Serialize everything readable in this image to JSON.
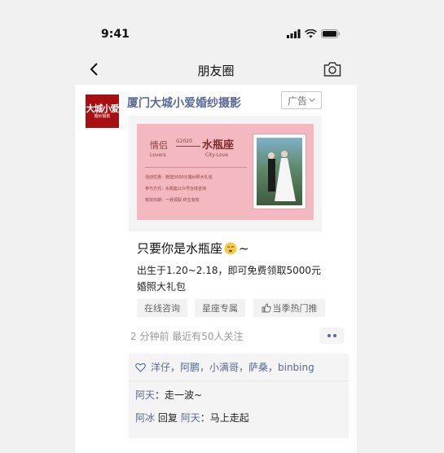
{
  "status_bar": {
    "time": "9:41"
  },
  "nav": {
    "title": "朋友圈"
  },
  "post": {
    "author": "厦门大城小爱婚纱摄影",
    "avatar_text": "大城小爱",
    "avatar_subtext": "婚纱摄影",
    "ad_label": "广告",
    "banner": {
      "left_title": "情侣",
      "left_sub": "Lovers",
      "year": "G2020",
      "right_title": "水瓶座",
      "right_sub": "City-Love",
      "line1": "活动优惠：赠送5000元婚纱照大礼包",
      "line2": "参与方式：水瓶座公众号在线咨询",
      "line3": "有效日期：一经领取 终生有效"
    },
    "caption": "只要你是水瓶座",
    "caption_tail": "~",
    "description": "出生于1.20~2.18，即可免费领取5000元婚照大礼包",
    "chips": [
      "在线咨询",
      "星座专属",
      "当季热门推"
    ],
    "meta": "2 分钟前 最近有50人关注",
    "likes": "洋仔，阿鹏，小满哥，萨桑，binbing",
    "comments": [
      {
        "name": "阿天",
        "separator": "：",
        "text": "走一波~"
      },
      {
        "name": "阿冰",
        "reply_word": "回复",
        "reply_to": "阿天",
        "separator": "：",
        "text": "马上走起"
      }
    ]
  },
  "colors": {
    "link": "#576b95",
    "banner_bg": "#f4b8c0",
    "avatar_bg": "#a80f12"
  }
}
